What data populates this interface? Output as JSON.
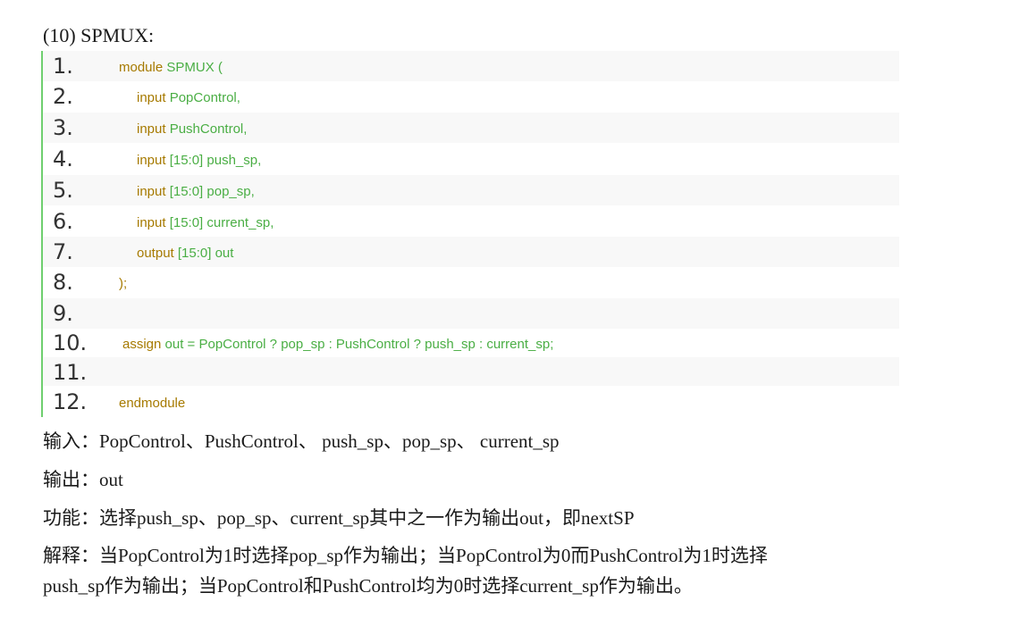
{
  "heading": "(10) SPMUX:",
  "code": {
    "lines": [
      {
        "num": "1.",
        "kw": "module",
        "rest": " SPMUX ("
      },
      {
        "num": "2.",
        "kw": "input",
        "rest": " PopControl,"
      },
      {
        "num": "3.",
        "kw": "input",
        "rest": " PushControl,"
      },
      {
        "num": "4.",
        "kw": "input",
        "rest": " [15:0] push_sp,"
      },
      {
        "num": "5.",
        "kw": "input",
        "rest": " [15:0] pop_sp,"
      },
      {
        "num": "6.",
        "kw": "input",
        "rest": " [15:0] current_sp,"
      },
      {
        "num": "7.",
        "kw": "output",
        "rest": " [15:0] out"
      },
      {
        "num": "8.",
        "kw": "",
        "rest": ");"
      },
      {
        "num": "9.",
        "kw": "",
        "rest": ""
      },
      {
        "num": "10.",
        "kw": "assign",
        "rest": " out = PopControl ? pop_sp : PushControl ? push_sp : current_sp;"
      },
      {
        "num": "11.",
        "kw": "",
        "rest": ""
      },
      {
        "num": "12.",
        "kw": "endmodule",
        "rest": ""
      }
    ]
  },
  "paragraphs": {
    "inputs": "输入：PopControl、PushControl、 push_sp、pop_sp、 current_sp",
    "outputs": "输出：out",
    "function": "功能：选择push_sp、pop_sp、current_sp其中之一作为输出out，即nextSP",
    "explain_line1": "解释：当PopControl为1时选择pop_sp作为输出；当PopControl为0而PushControl为1时选择",
    "explain_line2": "push_sp作为输出；当PopControl和PushControl均为0时选择current_sp作为输出。"
  }
}
